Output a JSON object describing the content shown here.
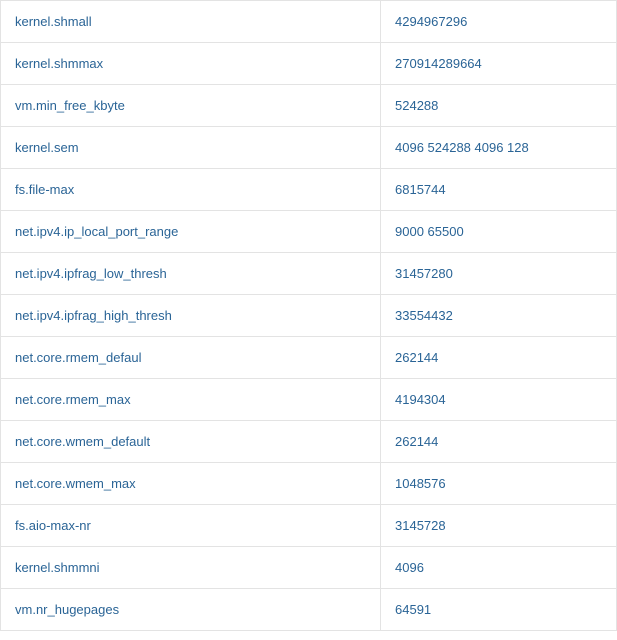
{
  "rows": [
    {
      "param": "kernel.shmall",
      "value": "4294967296"
    },
    {
      "param": "kernel.shmmax",
      "value": "270914289664"
    },
    {
      "param": "vm.min_free_kbyte",
      "value": "524288"
    },
    {
      "param": "kernel.sem",
      "value": "4096 524288 4096 128"
    },
    {
      "param": "fs.file-max",
      "value": "6815744"
    },
    {
      "param": "net.ipv4.ip_local_port_range",
      "value": "9000 65500"
    },
    {
      "param": "net.ipv4.ipfrag_low_thresh",
      "value": "31457280"
    },
    {
      "param": "net.ipv4.ipfrag_high_thresh",
      "value": "33554432"
    },
    {
      "param": "net.core.rmem_defaul",
      "value": "262144"
    },
    {
      "param": "net.core.rmem_max",
      "value": "4194304"
    },
    {
      "param": "net.core.wmem_default",
      "value": "262144"
    },
    {
      "param": "net.core.wmem_max",
      "value": "1048576"
    },
    {
      "param": "fs.aio-max-nr",
      "value": "3145728"
    },
    {
      "param": "kernel.shmmni",
      "value": "4096"
    },
    {
      "param": "vm.nr_hugepages",
      "value": "64591"
    }
  ]
}
